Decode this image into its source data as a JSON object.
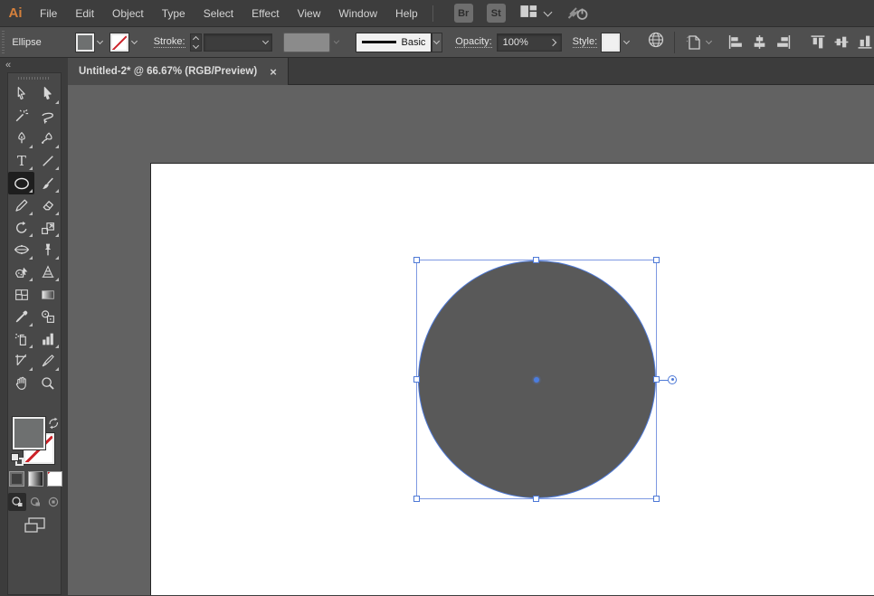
{
  "app": {
    "logo_text": "Ai"
  },
  "menubar": {
    "items": [
      "File",
      "Edit",
      "Object",
      "Type",
      "Select",
      "Effect",
      "View",
      "Window",
      "Help"
    ],
    "bridge_button": "Br",
    "stock_button": "St"
  },
  "control_bar": {
    "tool_name": "Ellipse",
    "stroke_label": "Stroke:",
    "stroke_width_value": "",
    "profile_name": "Basic",
    "opacity_label": "Opacity:",
    "opacity_value": "100%",
    "style_label": "Style:"
  },
  "tabbar": {
    "document_title": "Untitled-2* @ 66.67% (RGB/Preview)",
    "close_glyph": "×"
  },
  "toolbar": {
    "collapse_glyph": "«",
    "selected_tool": "ellipse",
    "tools": [
      "selection",
      "direct-selection",
      "magic-wand",
      "lasso",
      "pen",
      "curvature",
      "type",
      "line-segment",
      "ellipse",
      "paintbrush",
      "pencil",
      "eraser",
      "rotate",
      "scale",
      "width",
      "puppet-warp",
      "shape-builder",
      "perspective-grid",
      "mesh",
      "gradient",
      "eyedropper",
      "blend",
      "symbol-sprayer",
      "column-graph",
      "artboard",
      "slice",
      "hand",
      "zoom"
    ]
  },
  "icons": {
    "type_glyph": "T"
  },
  "canvas": {
    "pasteboard_color": "#626262",
    "artboard_color": "#ffffff",
    "shape": {
      "type": "ellipse",
      "fill": "#595959",
      "selected": true
    }
  },
  "colors": {
    "selection_blue": "#4e79d6",
    "logo_orange": "#d6813c",
    "shape_fill": "#595959",
    "none_slash_red": "#cc2229"
  }
}
